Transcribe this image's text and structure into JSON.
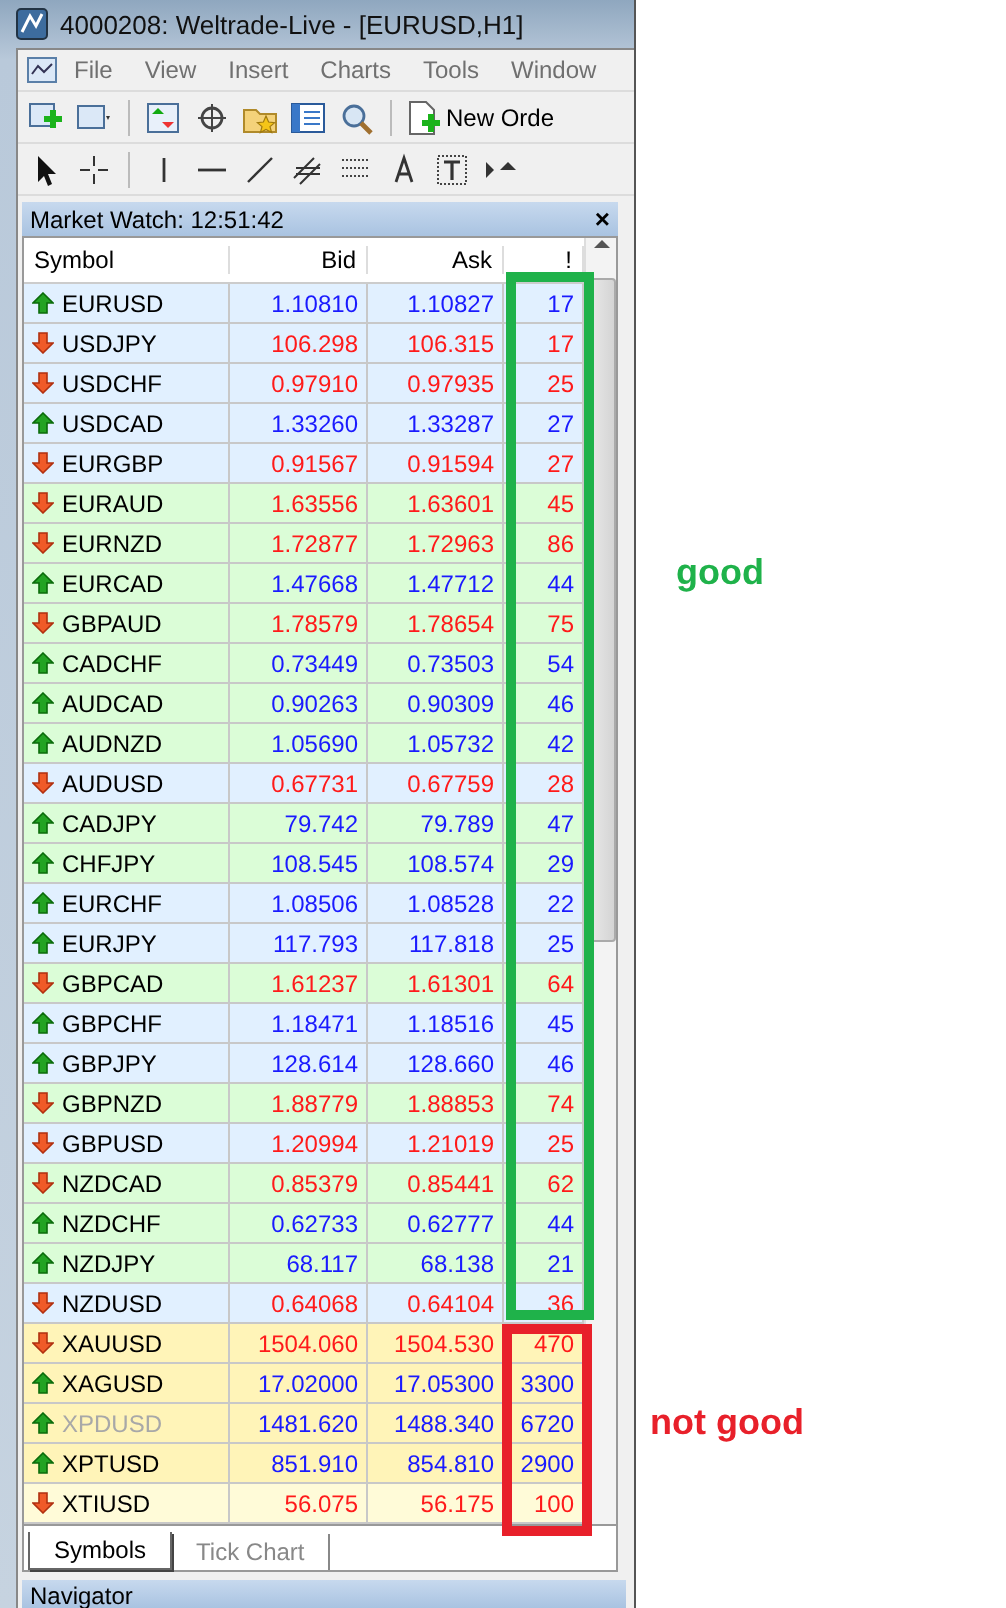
{
  "window": {
    "title": "4000208: Weltrade-Live - [EURUSD,H1]"
  },
  "menu": [
    "File",
    "View",
    "Insert",
    "Charts",
    "Tools",
    "Window"
  ],
  "toolbar": {
    "new_order": "New Orde"
  },
  "market_watch": {
    "title": "Market Watch: 12:51:42",
    "close": "×",
    "columns": [
      "Symbol",
      "Bid",
      "Ask",
      "!"
    ],
    "rows": [
      {
        "symbol": "EURUSD",
        "rising": true,
        "bid": "1.10810",
        "ask": "1.10827",
        "spread": "17",
        "color": "#e1f0ff",
        "dimmed": false
      },
      {
        "symbol": "USDJPY",
        "rising": false,
        "bid": "106.298",
        "ask": "106.315",
        "spread": "17",
        "color": "#e1f0ff",
        "dimmed": false
      },
      {
        "symbol": "USDCHF",
        "rising": false,
        "bid": "0.97910",
        "ask": "0.97935",
        "spread": "25",
        "color": "#e1f0ff",
        "dimmed": false
      },
      {
        "symbol": "USDCAD",
        "rising": true,
        "bid": "1.33260",
        "ask": "1.33287",
        "spread": "27",
        "color": "#e1f0ff",
        "dimmed": false
      },
      {
        "symbol": "EURGBP",
        "rising": false,
        "bid": "0.91567",
        "ask": "0.91594",
        "spread": "27",
        "color": "#e1f0ff",
        "dimmed": false
      },
      {
        "symbol": "EURAUD",
        "rising": false,
        "bid": "1.63556",
        "ask": "1.63601",
        "spread": "45",
        "color": "#dbfdd7",
        "dimmed": false
      },
      {
        "symbol": "EURNZD",
        "rising": false,
        "bid": "1.72877",
        "ask": "1.72963",
        "spread": "86",
        "color": "#dbfdd7",
        "dimmed": false
      },
      {
        "symbol": "EURCAD",
        "rising": true,
        "bid": "1.47668",
        "ask": "1.47712",
        "spread": "44",
        "color": "#dbfdd7",
        "dimmed": false
      },
      {
        "symbol": "GBPAUD",
        "rising": false,
        "bid": "1.78579",
        "ask": "1.78654",
        "spread": "75",
        "color": "#dbfdd7",
        "dimmed": false
      },
      {
        "symbol": "CADCHF",
        "rising": true,
        "bid": "0.73449",
        "ask": "0.73503",
        "spread": "54",
        "color": "#dbfdd7",
        "dimmed": false
      },
      {
        "symbol": "AUDCAD",
        "rising": true,
        "bid": "0.90263",
        "ask": "0.90309",
        "spread": "46",
        "color": "#dbfdd7",
        "dimmed": false
      },
      {
        "symbol": "AUDNZD",
        "rising": true,
        "bid": "1.05690",
        "ask": "1.05732",
        "spread": "42",
        "color": "#dbfdd7",
        "dimmed": false
      },
      {
        "symbol": "AUDUSD",
        "rising": false,
        "bid": "0.67731",
        "ask": "0.67759",
        "spread": "28",
        "color": "#e1f0ff",
        "dimmed": false
      },
      {
        "symbol": "CADJPY",
        "rising": true,
        "bid": "79.742",
        "ask": "79.789",
        "spread": "47",
        "color": "#dbfdd7",
        "dimmed": false
      },
      {
        "symbol": "CHFJPY",
        "rising": true,
        "bid": "108.545",
        "ask": "108.574",
        "spread": "29",
        "color": "#dbfdd7",
        "dimmed": false
      },
      {
        "symbol": "EURCHF",
        "rising": true,
        "bid": "1.08506",
        "ask": "1.08528",
        "spread": "22",
        "color": "#e1f0ff",
        "dimmed": false
      },
      {
        "symbol": "EURJPY",
        "rising": true,
        "bid": "117.793",
        "ask": "117.818",
        "spread": "25",
        "color": "#e1f0ff",
        "dimmed": false
      },
      {
        "symbol": "GBPCAD",
        "rising": false,
        "bid": "1.61237",
        "ask": "1.61301",
        "spread": "64",
        "color": "#dbfdd7",
        "dimmed": false
      },
      {
        "symbol": "GBPCHF",
        "rising": true,
        "bid": "1.18471",
        "ask": "1.18516",
        "spread": "45",
        "color": "#e1f0ff",
        "dimmed": false
      },
      {
        "symbol": "GBPJPY",
        "rising": true,
        "bid": "128.614",
        "ask": "128.660",
        "spread": "46",
        "color": "#e1f0ff",
        "dimmed": false
      },
      {
        "symbol": "GBPNZD",
        "rising": false,
        "bid": "1.88779",
        "ask": "1.88853",
        "spread": "74",
        "color": "#dbfdd7",
        "dimmed": false
      },
      {
        "symbol": "GBPUSD",
        "rising": false,
        "bid": "1.20994",
        "ask": "1.21019",
        "spread": "25",
        "color": "#e1f0ff",
        "dimmed": false
      },
      {
        "symbol": "NZDCAD",
        "rising": false,
        "bid": "0.85379",
        "ask": "0.85441",
        "spread": "62",
        "color": "#dbfdd7",
        "dimmed": false
      },
      {
        "symbol": "NZDCHF",
        "rising": true,
        "bid": "0.62733",
        "ask": "0.62777",
        "spread": "44",
        "color": "#dbfdd7",
        "dimmed": false
      },
      {
        "symbol": "NZDJPY",
        "rising": true,
        "bid": "68.117",
        "ask": "68.138",
        "spread": "21",
        "color": "#dbfdd7",
        "dimmed": false
      },
      {
        "symbol": "NZDUSD",
        "rising": false,
        "bid": "0.64068",
        "ask": "0.64104",
        "spread": "36",
        "color": "#e1f0ff",
        "dimmed": false
      },
      {
        "symbol": "XAUUSD",
        "rising": false,
        "bid": "1504.060",
        "ask": "1504.530",
        "spread": "470",
        "color": "#fff4b8",
        "dimmed": false
      },
      {
        "symbol": "XAGUSD",
        "rising": true,
        "bid": "17.02000",
        "ask": "17.05300",
        "spread": "3300",
        "color": "#fff4b8",
        "dimmed": false
      },
      {
        "symbol": "XPDUSD",
        "rising": true,
        "bid": "1481.620",
        "ask": "1488.340",
        "spread": "6720",
        "color": "#fff4b8",
        "dimmed": true
      },
      {
        "symbol": "XPTUSD",
        "rising": true,
        "bid": "851.910",
        "ask": "854.810",
        "spread": "2900",
        "color": "#fff4b8",
        "dimmed": false
      },
      {
        "symbol": "XTIUSD",
        "rising": false,
        "bid": "56.075",
        "ask": "56.175",
        "spread": "100",
        "color": "#fffbd8",
        "dimmed": false
      }
    ],
    "tabs": [
      {
        "label": "Symbols",
        "selected": true
      },
      {
        "label": "Tick Chart",
        "selected": false
      }
    ]
  },
  "navigator": {
    "title": "Navigator"
  },
  "annotations": [
    {
      "label": "good",
      "color": "#1fb24a"
    },
    {
      "label": "not good",
      "color": "#e8202a"
    }
  ]
}
